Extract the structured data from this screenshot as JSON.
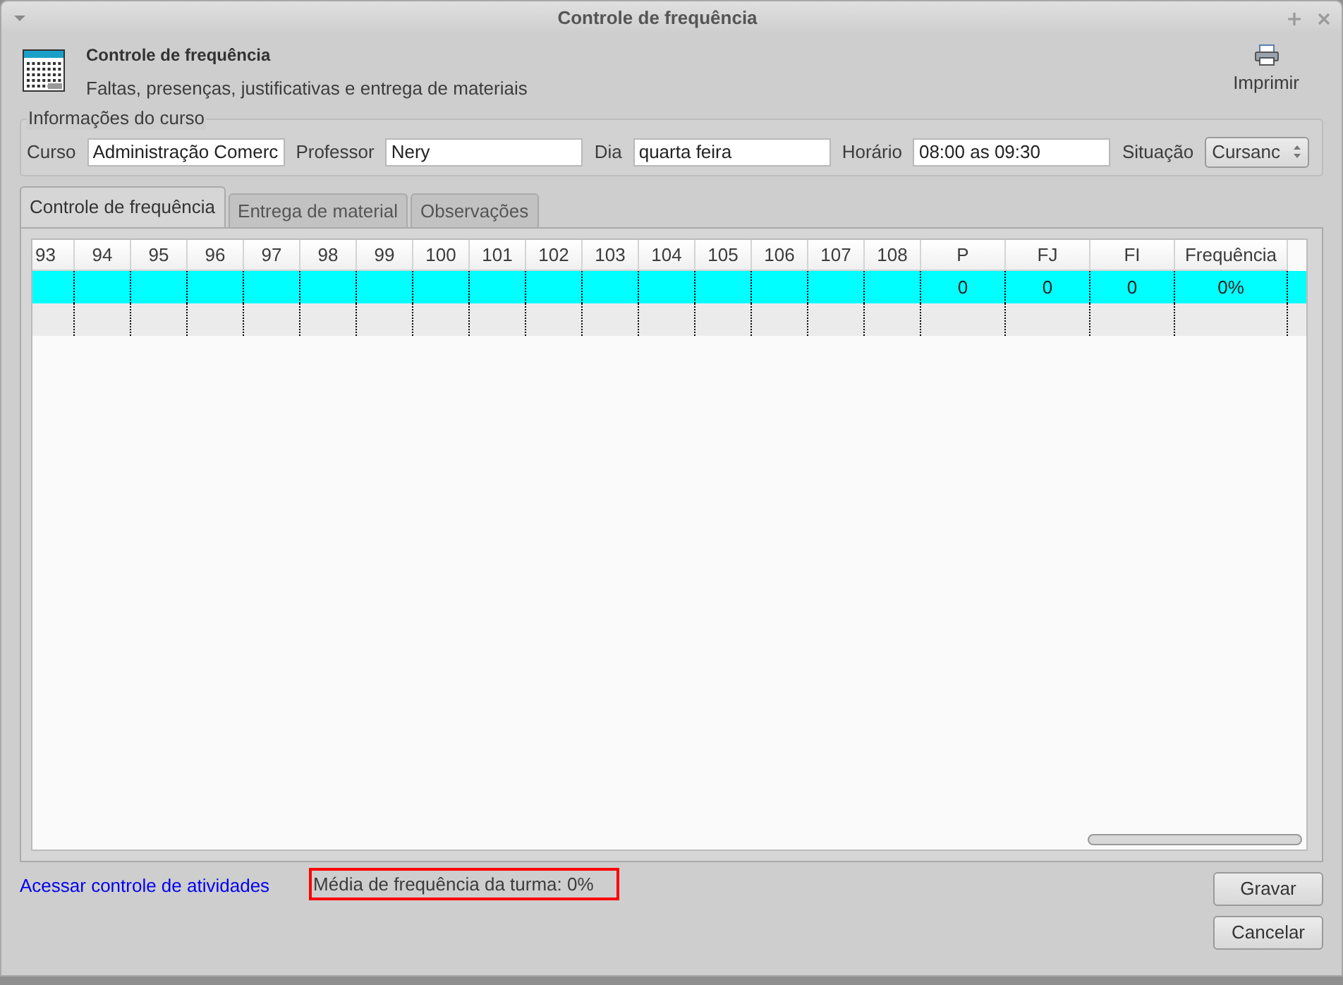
{
  "window": {
    "title": "Controle de frequência"
  },
  "header": {
    "title": "Controle de frequência",
    "subtitle": "Faltas, presenças, justificativas e entrega de materiais",
    "print_label": "Imprimir"
  },
  "course_info": {
    "legend": "Informações do curso",
    "fields": [
      {
        "label": "Curso",
        "value": "Administração Comerc",
        "kind": "text"
      },
      {
        "label": "Professor",
        "value": "Nery",
        "kind": "text"
      },
      {
        "label": "Dia",
        "value": "quarta feira",
        "kind": "text"
      },
      {
        "label": "Horário",
        "value": "08:00 as 09:30",
        "kind": "text"
      },
      {
        "label": "Situação",
        "value": "Cursanc",
        "kind": "combo"
      }
    ]
  },
  "tabs": [
    {
      "label": "Controle de frequência",
      "selected": true
    },
    {
      "label": "Entrega de material",
      "selected": false
    },
    {
      "label": "Observações",
      "selected": false
    }
  ],
  "table": {
    "columns": [
      "93",
      "94",
      "95",
      "96",
      "97",
      "98",
      "99",
      "100",
      "101",
      "102",
      "103",
      "104",
      "105",
      "106",
      "107",
      "108",
      "P",
      "FJ",
      "FI",
      "Frequência"
    ],
    "rows": [
      {
        "selected": true,
        "totals": [
          "0",
          "0",
          "0",
          "0%"
        ]
      },
      {
        "selected": false
      }
    ]
  },
  "footer": {
    "link": "Acessar controle de atividades",
    "average": "Média de frequência da turma: 0%",
    "highlighted": true
  },
  "buttons": [
    "Gravar",
    "Cancelar"
  ]
}
